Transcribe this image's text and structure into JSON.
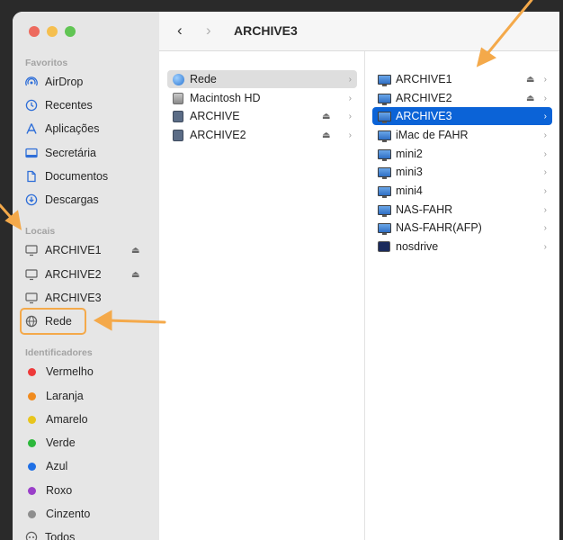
{
  "toolbar": {
    "back_icon": "chevron-left-icon",
    "forward_icon": "chevron-right-icon",
    "title": "ARCHIVE3"
  },
  "sidebar": {
    "favorites_title": "Favoritos",
    "favorites": [
      {
        "label": "AirDrop",
        "icon": "airdrop-icon"
      },
      {
        "label": "Recentes",
        "icon": "clock-icon"
      },
      {
        "label": "Aplicações",
        "icon": "apps-icon"
      },
      {
        "label": "Secretária",
        "icon": "desktop-icon"
      },
      {
        "label": "Documentos",
        "icon": "document-icon"
      },
      {
        "label": "Descargas",
        "icon": "download-icon"
      }
    ],
    "locations_title": "Locais",
    "locations": [
      {
        "label": "ARCHIVE1",
        "eject": "⏏"
      },
      {
        "label": "ARCHIVE2",
        "eject": "⏏"
      },
      {
        "label": "ARCHIVE3"
      },
      {
        "label": "Rede"
      }
    ],
    "tags_title": "Identificadores",
    "tags": [
      {
        "label": "Vermelho",
        "color": "#ee3a3a"
      },
      {
        "label": "Laranja",
        "color": "#f08b1e"
      },
      {
        "label": "Amarelo",
        "color": "#e8c51d"
      },
      {
        "label": "Verde",
        "color": "#2cb83b"
      },
      {
        "label": "Azul",
        "color": "#1f6fe5"
      },
      {
        "label": "Roxo",
        "color": "#9a3fc9"
      },
      {
        "label": "Cinzento",
        "color": "#8e8e8e"
      },
      {
        "label": "Todos"
      }
    ]
  },
  "column1": {
    "items": [
      {
        "label": "Rede",
        "icon": "globe-icon",
        "selected": true
      },
      {
        "label": "Macintosh HD",
        "icon": "disk-icon"
      },
      {
        "label": "ARCHIVE",
        "icon": "external-disk-icon",
        "eject": "⏏"
      },
      {
        "label": "ARCHIVE2",
        "icon": "external-disk-icon",
        "eject": "⏏"
      }
    ]
  },
  "column2": {
    "items": [
      {
        "label": "ARCHIVE1",
        "eject": "⏏"
      },
      {
        "label": "ARCHIVE2",
        "eject": "⏏"
      },
      {
        "label": "ARCHIVE3",
        "selected": true
      },
      {
        "label": "iMac de FAHR"
      },
      {
        "label": "mini2"
      },
      {
        "label": "mini3"
      },
      {
        "label": "mini4"
      },
      {
        "label": "NAS-FAHR"
      },
      {
        "label": "NAS-FAHR(AFP)"
      },
      {
        "label": "nosdrive"
      }
    ]
  },
  "colors": {
    "accent": "#0b63d7",
    "annotation_arrow": "#f4a94a"
  }
}
